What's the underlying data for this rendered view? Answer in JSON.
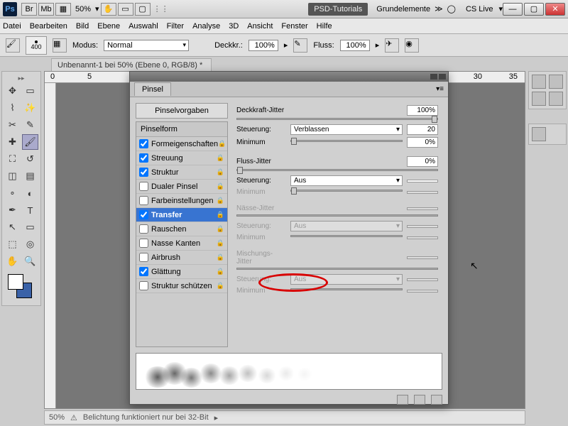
{
  "title": {
    "zoom": "50%",
    "ws1": "PSD-Tutorials",
    "ws2": "Grundelemente",
    "cslive": "CS Live"
  },
  "menu": [
    "Datei",
    "Bearbeiten",
    "Bild",
    "Ebene",
    "Auswahl",
    "Filter",
    "Analyse",
    "3D",
    "Ansicht",
    "Fenster",
    "Hilfe"
  ],
  "opt": {
    "size": "400",
    "modeLabel": "Modus:",
    "mode": "Normal",
    "opacLabel": "Deckkr.:",
    "opac": "100%",
    "flowLabel": "Fluss:",
    "flow": "100%"
  },
  "doc": "Unbenannt-1 bei 50% (Ebene 0, RGB/8) *",
  "status": {
    "zoom": "50%",
    "msg": "Belichtung funktioniert nur bei 32-Bit"
  },
  "panel": {
    "tab": "Pinsel",
    "presets": "Pinselvorgaben",
    "shapehdr": "Pinselform",
    "opts": [
      {
        "l": "Formeigenschaften",
        "c": true
      },
      {
        "l": "Streuung",
        "c": true
      },
      {
        "l": "Struktur",
        "c": true
      },
      {
        "l": "Dualer Pinsel",
        "c": false
      },
      {
        "l": "Farbeinstellungen",
        "c": false
      },
      {
        "l": "Transfer",
        "c": true,
        "sel": true
      },
      {
        "l": "Rauschen",
        "c": false
      },
      {
        "l": "Nasse Kanten",
        "c": false
      },
      {
        "l": "Airbrush",
        "c": false
      },
      {
        "l": "Glättung",
        "c": true
      },
      {
        "l": "Struktur schützen",
        "c": false
      }
    ],
    "r": {
      "s1": {
        "t": "Deckkraft-Jitter",
        "v": "100%",
        "ctl": "Steuerung:",
        "ctlv": "Verblassen",
        "ctln": "20",
        "min": "Minimum",
        "minv": "0%"
      },
      "s2": {
        "t": "Fluss-Jitter",
        "v": "0%",
        "ctl": "Steuerung:",
        "ctlv": "Aus",
        "min": "Minimum"
      },
      "s3": {
        "t": "Nässe-Jitter",
        "ctl": "Steuerung:",
        "ctlv": "Aus",
        "min": "Minimum"
      },
      "s4": {
        "t": "Mischungs-Jitter",
        "ctl": "Steuerung:",
        "ctlv": "Aus",
        "min": "Minimum"
      }
    }
  }
}
